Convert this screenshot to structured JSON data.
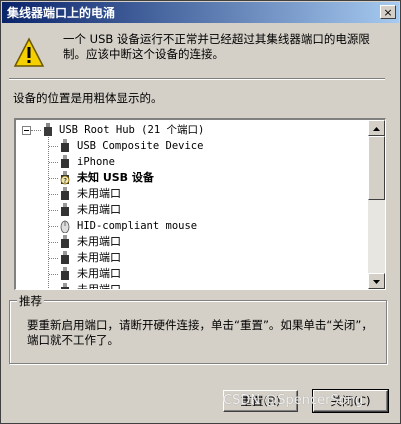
{
  "window": {
    "title": "集线器端口上的电涌",
    "close_glyph": "×"
  },
  "message": "一个 USB 设备运行不正常并已经超过其集线器端口的电源限制。应该中断这个设备的连接。",
  "hint": "设备的位置是用粗体显示的。",
  "tree": {
    "root": "USB Root Hub (21 个端口)",
    "items": [
      {
        "label": "USB Composite Device",
        "bold": false,
        "icon": "usb-plug-icon"
      },
      {
        "label": "iPhone",
        "bold": false,
        "icon": "usb-plug-icon"
      },
      {
        "label": "未知 USB 设备",
        "bold": true,
        "icon": "unknown-device-icon"
      },
      {
        "label": "未用端口",
        "bold": false,
        "icon": "usb-plug-icon"
      },
      {
        "label": "未用端口",
        "bold": false,
        "icon": "usb-plug-icon"
      },
      {
        "label": "HID-compliant mouse",
        "bold": false,
        "icon": "mouse-icon"
      },
      {
        "label": "未用端口",
        "bold": false,
        "icon": "usb-plug-icon"
      },
      {
        "label": "未用端口",
        "bold": false,
        "icon": "usb-plug-icon"
      },
      {
        "label": "未用端口",
        "bold": false,
        "icon": "usb-plug-icon"
      },
      {
        "label": "未用端口",
        "bold": false,
        "icon": "usb-plug-icon"
      }
    ]
  },
  "recommendation": {
    "legend": "推荐",
    "text": "要重新启用端口，请断开硬件连接，单击“重置”。如果单击“关闭”，端口就不工作了。"
  },
  "buttons": {
    "reset": "重置(R)",
    "close": "关闭(C)"
  },
  "watermark": "CSDN @SpencerSong",
  "colors": {
    "titlebar_start": "#0a246a",
    "titlebar_end": "#a6caf0",
    "face": "#d4d0c8"
  }
}
